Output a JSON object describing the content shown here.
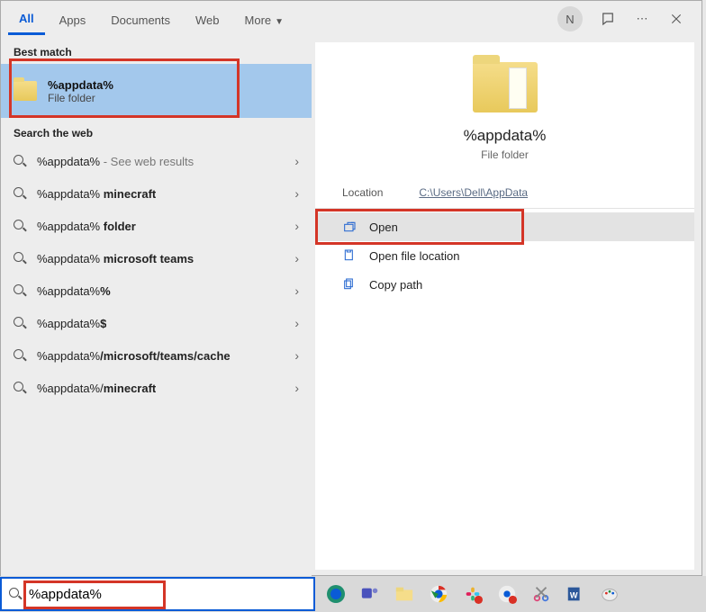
{
  "tabs": {
    "all": "All",
    "apps": "Apps",
    "documents": "Documents",
    "web": "Web",
    "more": "More"
  },
  "user_initial": "N",
  "section": {
    "best_match": "Best match",
    "search_web": "Search the web"
  },
  "best_match": {
    "title": "%appdata%",
    "subtitle": "File folder"
  },
  "web_results": [
    {
      "prefix": "%appdata%",
      "suffix": "",
      "hint": " - See web results"
    },
    {
      "prefix": "%appdata%",
      "suffix": " minecraft",
      "hint": ""
    },
    {
      "prefix": "%appdata%",
      "suffix": " folder",
      "hint": ""
    },
    {
      "prefix": "%appdata%",
      "suffix": " microsoft teams",
      "hint": ""
    },
    {
      "prefix": "%appdata%",
      "suffix": "%",
      "hint": ""
    },
    {
      "prefix": "%appdata%",
      "suffix": "$",
      "hint": ""
    },
    {
      "prefix": "%appdata%",
      "suffix": "/microsoft/teams/cache",
      "hint": ""
    },
    {
      "prefix": "%appdata%/",
      "suffix": "minecraft",
      "hint": ""
    }
  ],
  "preview": {
    "title": "%appdata%",
    "subtitle": "File folder",
    "location_label": "Location",
    "location_value": "C:\\Users\\Dell\\AppData",
    "actions": {
      "open": "Open",
      "open_location": "Open file location",
      "copy_path": "Copy path"
    }
  },
  "search_input": "%appdata%"
}
